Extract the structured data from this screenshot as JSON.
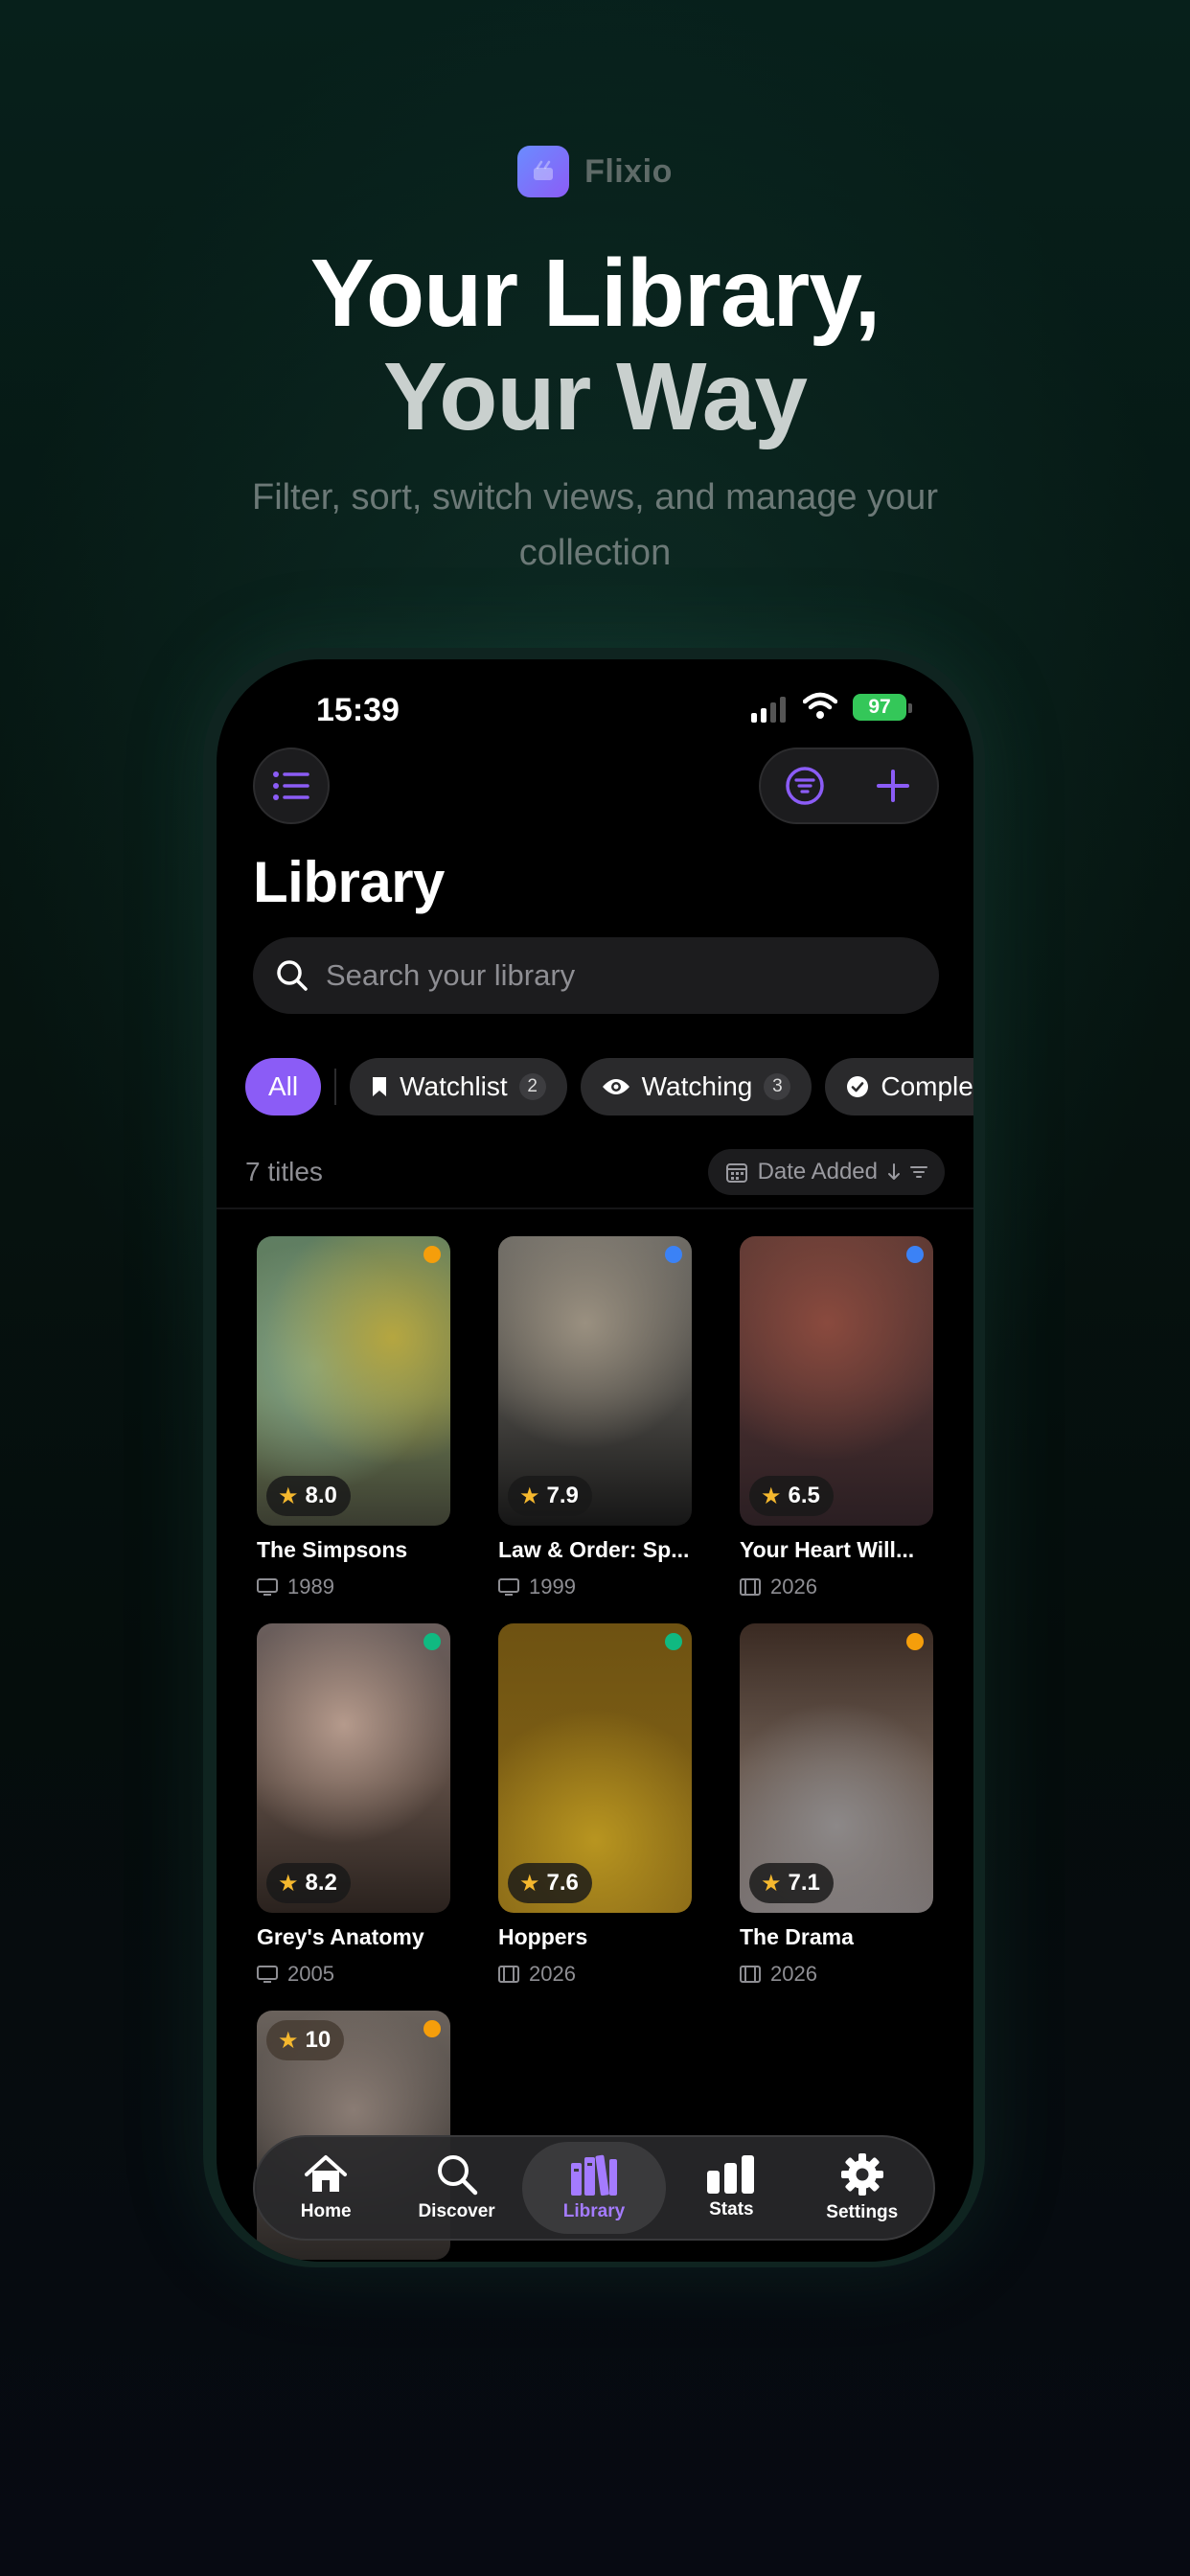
{
  "brand": {
    "name": "Flixio"
  },
  "hero": {
    "headline_line1": "Your Library,",
    "headline_line2": "Your Way",
    "subheading": "Filter, sort, switch views, and manage your collection"
  },
  "status_bar": {
    "time": "15:39",
    "battery": "97"
  },
  "toolbar": {
    "menu_icon": "list-icon",
    "filter_icon": "filter-icon",
    "add_icon": "plus-icon"
  },
  "page": {
    "title": "Library"
  },
  "search": {
    "placeholder": "Search your library",
    "value": ""
  },
  "filters": [
    {
      "label": "All",
      "active": true
    },
    {
      "label": "Watchlist",
      "count": "2",
      "icon": "bookmark-icon"
    },
    {
      "label": "Watching",
      "count": "3",
      "icon": "eye-icon"
    },
    {
      "label": "Completed",
      "icon": "check-circle-icon"
    }
  ],
  "summary": {
    "count_label": "7 titles",
    "sort_label": "Date Added"
  },
  "status_colors": {
    "orange": "#f59e0b",
    "blue": "#3b82f6",
    "green": "#10b981",
    "accent": "#8b5cf6"
  },
  "titles": [
    {
      "name": "The Simpsons",
      "rating": "8.0",
      "year": "1989",
      "kind": "tv",
      "status_color": "#f59e0b"
    },
    {
      "name": "Law & Order: Sp...",
      "rating": "7.9",
      "year": "1999",
      "kind": "tv",
      "status_color": "#3b82f6"
    },
    {
      "name": "Your Heart Will...",
      "rating": "6.5",
      "year": "2026",
      "kind": "movie",
      "status_color": "#3b82f6"
    },
    {
      "name": "Grey's Anatomy",
      "rating": "8.2",
      "year": "2005",
      "kind": "tv",
      "status_color": "#10b981"
    },
    {
      "name": "Hoppers",
      "rating": "7.6",
      "year": "2026",
      "kind": "movie",
      "status_color": "#10b981"
    },
    {
      "name": "The Drama",
      "rating": "7.1",
      "year": "2026",
      "kind": "movie",
      "status_color": "#f59e0b"
    },
    {
      "name": "",
      "rating": "10",
      "year": "",
      "kind": "tv",
      "status_color": "#f59e0b"
    }
  ],
  "tabs": [
    {
      "label": "Home",
      "icon": "house-icon"
    },
    {
      "label": "Discover",
      "icon": "magnifier-icon"
    },
    {
      "label": "Library",
      "icon": "books-icon",
      "active": true
    },
    {
      "label": "Stats",
      "icon": "bar-chart-icon"
    },
    {
      "label": "Settings",
      "icon": "gear-icon"
    }
  ]
}
